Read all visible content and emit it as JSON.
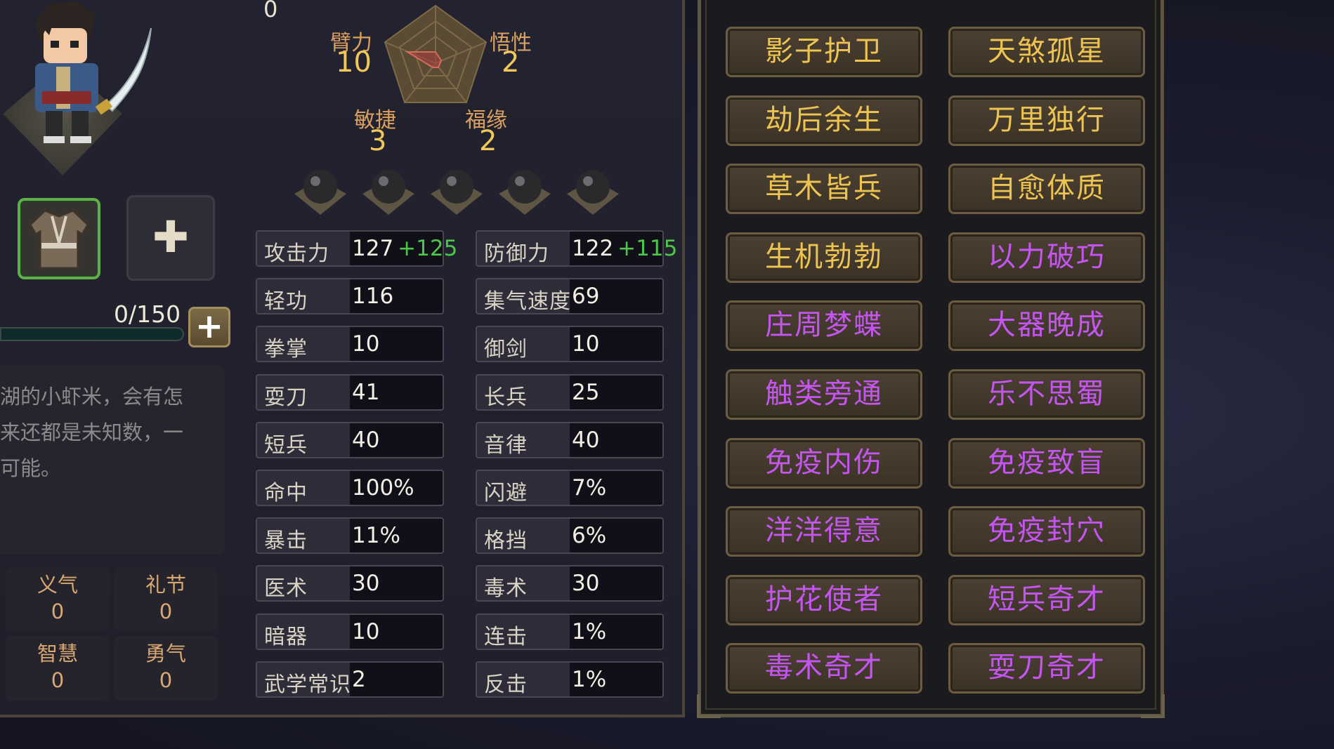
{
  "top_counter": "0",
  "radar": {
    "strength": {
      "label": "臂力",
      "value": "10"
    },
    "insight": {
      "label": "悟性",
      "value": "2"
    },
    "agility": {
      "label": "敏捷",
      "value": "3"
    },
    "fortune": {
      "label": "福缘",
      "value": "2"
    }
  },
  "equip": {
    "robe_icon": "robe-icon",
    "add_icon": "plus-icon"
  },
  "exp": {
    "text": "0/150",
    "fraction": 0.0,
    "add_label": "+"
  },
  "description": [
    "湖的小虾米，会有怎",
    "来还都是未知数，一",
    "可能。"
  ],
  "virtues": [
    {
      "label": "义气",
      "value": "0"
    },
    {
      "label": "礼节",
      "value": "0"
    },
    {
      "label": "智慧",
      "value": "0"
    },
    {
      "label": "勇气",
      "value": "0"
    }
  ],
  "stats_left": [
    {
      "label": "攻击力",
      "value": "127",
      "bonus": "+125"
    },
    {
      "label": "轻功",
      "value": "116",
      "bonus": ""
    },
    {
      "label": "拳掌",
      "value": "10",
      "bonus": ""
    },
    {
      "label": "耍刀",
      "value": "41",
      "bonus": ""
    },
    {
      "label": "短兵",
      "value": "40",
      "bonus": ""
    },
    {
      "label": "命中",
      "value": "100%",
      "bonus": ""
    },
    {
      "label": "暴击",
      "value": "11%",
      "bonus": ""
    },
    {
      "label": "医术",
      "value": "30",
      "bonus": ""
    },
    {
      "label": "暗器",
      "value": "10",
      "bonus": ""
    },
    {
      "label": "武学常识",
      "value": "2",
      "bonus": ""
    }
  ],
  "stats_right": [
    {
      "label": "防御力",
      "value": "122",
      "bonus": "+115"
    },
    {
      "label": "集气速度",
      "value": "69",
      "bonus": ""
    },
    {
      "label": "御剑",
      "value": "10",
      "bonus": ""
    },
    {
      "label": "长兵",
      "value": "25",
      "bonus": ""
    },
    {
      "label": "音律",
      "value": "40",
      "bonus": ""
    },
    {
      "label": "闪避",
      "value": "7%",
      "bonus": ""
    },
    {
      "label": "格挡",
      "value": "6%",
      "bonus": ""
    },
    {
      "label": "毒术",
      "value": "30",
      "bonus": ""
    },
    {
      "label": "连击",
      "value": "1%",
      "bonus": ""
    },
    {
      "label": "反击",
      "value": "1%",
      "bonus": ""
    }
  ],
  "traits": [
    {
      "label": "影子护卫",
      "tier": "gold"
    },
    {
      "label": "天煞孤星",
      "tier": "gold"
    },
    {
      "label": "劫后余生",
      "tier": "gold"
    },
    {
      "label": "万里独行",
      "tier": "gold"
    },
    {
      "label": "草木皆兵",
      "tier": "gold"
    },
    {
      "label": "自愈体质",
      "tier": "gold"
    },
    {
      "label": "生机勃勃",
      "tier": "gold"
    },
    {
      "label": "以力破巧",
      "tier": "purple"
    },
    {
      "label": "庄周梦蝶",
      "tier": "purple"
    },
    {
      "label": "大器晚成",
      "tier": "purple"
    },
    {
      "label": "触类旁通",
      "tier": "purple"
    },
    {
      "label": "乐不思蜀",
      "tier": "purple"
    },
    {
      "label": "免疫内伤",
      "tier": "purple"
    },
    {
      "label": "免疫致盲",
      "tier": "purple"
    },
    {
      "label": "洋洋得意",
      "tier": "purple"
    },
    {
      "label": "免疫封穴",
      "tier": "purple"
    },
    {
      "label": "护花使者",
      "tier": "purple"
    },
    {
      "label": "短兵奇才",
      "tier": "purple"
    },
    {
      "label": "毒术奇才",
      "tier": "purple"
    },
    {
      "label": "耍刀奇才",
      "tier": "purple"
    }
  ],
  "colors": {
    "gold_trait": "#eec451",
    "purple_trait": "#c455f0",
    "bonus_green": "#4cc64b"
  }
}
